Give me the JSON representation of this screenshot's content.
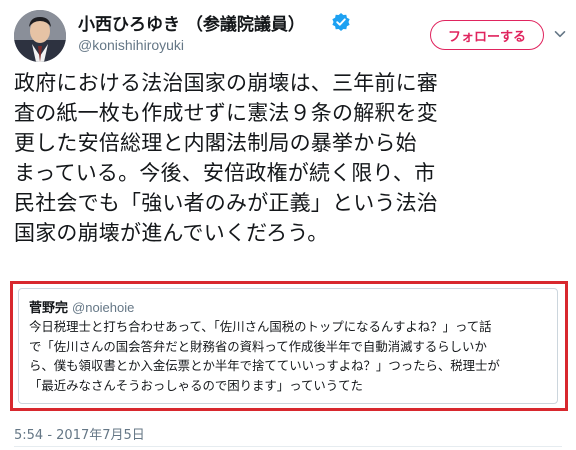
{
  "author": {
    "display_name": "小西ひろゆき （参議院議員）",
    "handle": "@konishihiroyuki",
    "avatar_icon": "profile-photo",
    "verified_icon": "verified-badge-icon"
  },
  "follow_button": {
    "label": "フォローする",
    "color": "#e0245e"
  },
  "menu_icon": "chevron-down-icon",
  "tweet": {
    "text": "政府における法治国家の崩壊は、三年前に審\n査の紙一枚も作成せずに憲法９条の解釈を変\n更した安倍総理と内閣法制局の暴挙から始\nまっている。今後、安倍政権が続く限り、市\n民社会でも「強い者のみが正義」という法治\n国家の崩壊が進んでいくだろう。"
  },
  "quoted_tweet": {
    "name": "菅野完",
    "handle": "@noiehoie",
    "text": "今日税理士と打ち合わせあって、「佐川さん国税のトップになるんすよね？」って話\nで「佐川さんの国会答弁だと財務省の資料って作成後半年で自動消滅するらしいか\nら、僕も領収書とか入金伝票とか半年で捨てていいっすよね？」つったら、税理士が\n「最近みなさんそうおっしゃるので困ります」っていうてた",
    "highlight_color": "#d8282e"
  },
  "timestamp": "5:54 - 2017年7月5日"
}
